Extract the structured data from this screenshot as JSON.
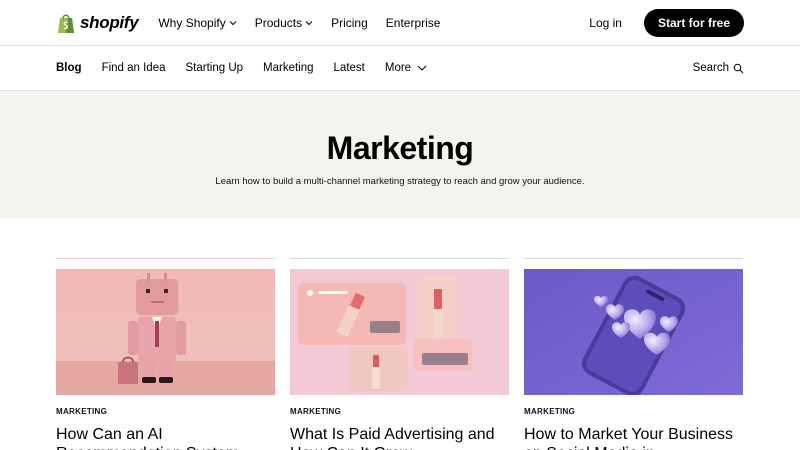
{
  "nav": {
    "logo_text": "shopify",
    "links": [
      {
        "label": "Why Shopify",
        "dropdown": true
      },
      {
        "label": "Products",
        "dropdown": true
      },
      {
        "label": "Pricing",
        "dropdown": false
      },
      {
        "label": "Enterprise",
        "dropdown": false
      }
    ],
    "login": "Log in",
    "cta": "Start for free",
    "brand_color": "#95bf47"
  },
  "subnav": {
    "items": [
      "Blog",
      "Find an Idea",
      "Starting Up",
      "Marketing",
      "Latest",
      "More"
    ],
    "active": "Blog",
    "search_label": "Search"
  },
  "hero": {
    "title": "Marketing",
    "subtitle": "Learn how to build a multi-channel marketing strategy to reach and grow your audience.",
    "background": "#f4f3ee"
  },
  "cards": [
    {
      "tag": "MARKETING",
      "title": "How Can an AI Recommendation System",
      "image": "pink-robot-illustration"
    },
    {
      "tag": "MARKETING",
      "title": "What Is Paid Advertising and How Can It Grow",
      "image": "lipstick-ads-illustration"
    },
    {
      "tag": "MARKETING",
      "title": "How to Market Your Business on Social Media in",
      "image": "phone-hearts-illustration"
    }
  ]
}
